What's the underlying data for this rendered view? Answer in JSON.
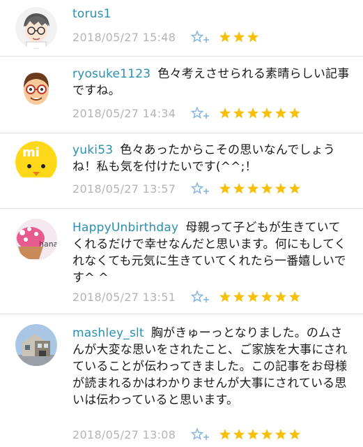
{
  "comments": [
    {
      "username": "torus1",
      "text": "",
      "timestamp": "2018/05/27 15:48",
      "star_count": 3,
      "avatar_icon": "cartoon-boy-glasses-icon"
    },
    {
      "username": "ryosuke1123",
      "text": "色々考えさせられる素晴らしい記事ですね。",
      "timestamp": "2018/05/27 14:34",
      "star_count": 6,
      "avatar_icon": "cartoon-man-glasses-icon"
    },
    {
      "username": "yuki53",
      "text": "色々あったからこその思いなんでしょうね！私も気を付けたいです(^^;！",
      "timestamp": "2018/05/27 13:57",
      "star_count": 6,
      "avatar_icon": "yellow-chick-icon"
    },
    {
      "username": "HappyUnbirthday",
      "text": "母親って子どもが生きていてくれるだけで幸せなんだと思います。何にもしてくれなくても元気に生きていてくれたら一番嬉しいです^ ^",
      "timestamp": "2018/05/27 13:51",
      "star_count": 6,
      "avatar_icon": "cupcake-hana-icon",
      "avatar_text": "hana"
    },
    {
      "username": "mashley_slt",
      "text": "胸がきゅーっとなりました。のムさんが大変な思いをされたこと、ご家族を大事にされていることが伝わってきました。この記事をお母様が読まれるかはわかりませんが大事にされている思いは伝わっていると思います。",
      "timestamp": "2018/05/27 13:08",
      "star_count": 6,
      "avatar_icon": "house-photo-icon"
    }
  ],
  "colors": {
    "username": "#2a8fb0",
    "timestamp": "#b4b4b4",
    "star": "#f5bf0a",
    "add_star": "#7fb3e0"
  }
}
